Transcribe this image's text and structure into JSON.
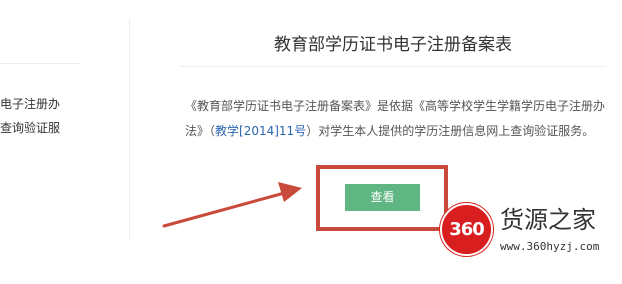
{
  "left_panel": {
    "line1": "电子注册办",
    "line2": "查询验证服"
  },
  "card": {
    "title": "教育部学历证书电子注册备案表",
    "desc_part1": "《教育部学历证书电子注册备案表》是依据《高等学校学生学籍学历电子注册办法》（",
    "desc_link": "教学[2014]11号",
    "desc_part2": "）对学生本人提供的学历注册信息网上查询验证服务。",
    "button_label": "查看"
  },
  "annotation": {
    "arrow_color": "#c9493a",
    "box_color": "#c9493a"
  },
  "watermark": {
    "badge": "360",
    "name": "货源之家",
    "url": "www.360hyzj.com"
  },
  "colors": {
    "button": "#5fb683",
    "link": "#2b66b0",
    "badge": "#d81e1e"
  }
}
